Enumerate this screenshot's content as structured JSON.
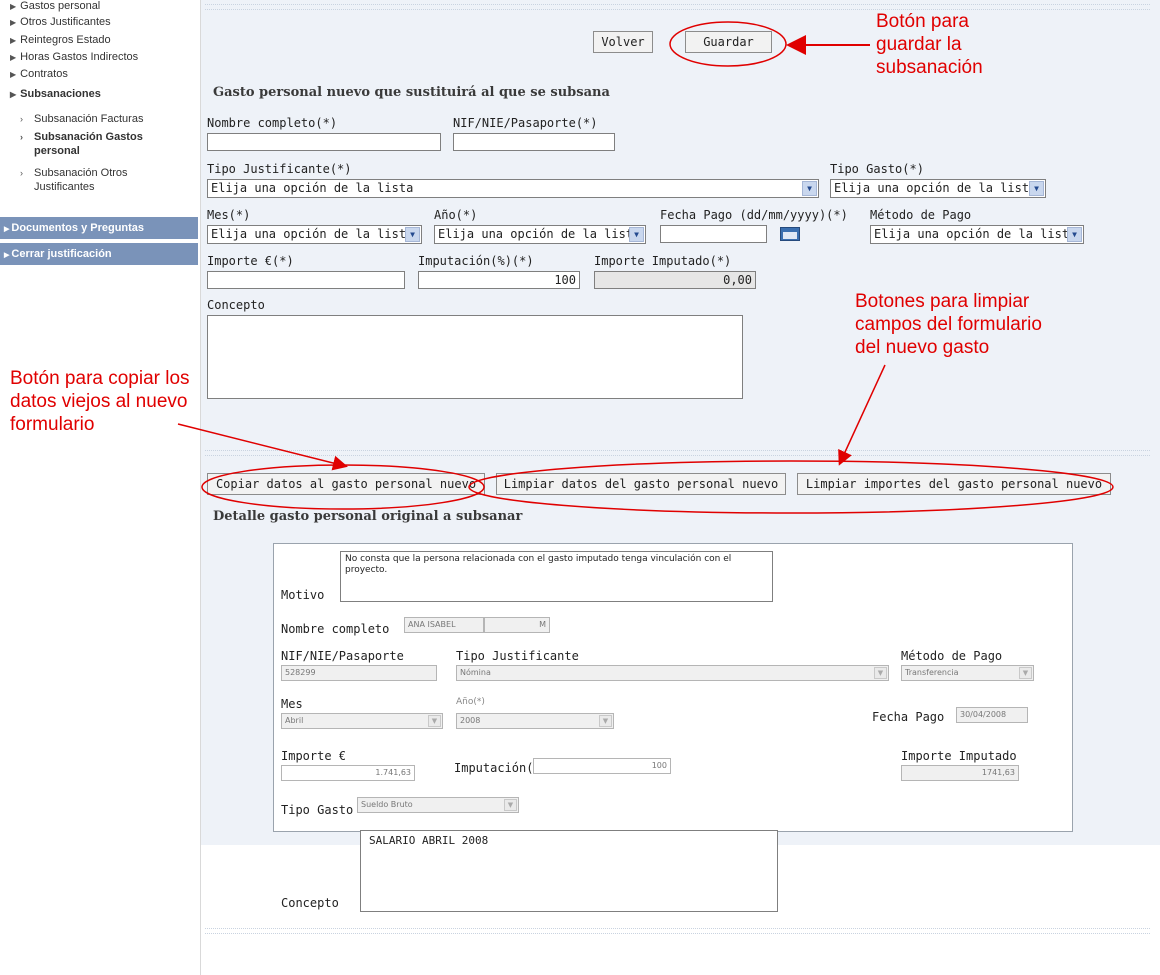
{
  "sidebar": {
    "links": [
      "Gastos personal",
      "Otros Justificantes",
      "Reintegros Estado",
      "Horas Gastos Indirectos",
      "Contratos"
    ],
    "section_label": "Subsanaciones",
    "sub_items": [
      {
        "label": "Subsanación Facturas"
      },
      {
        "label": "Subsanación Gastos personal"
      },
      {
        "label": "Subsanación Otros Justificantes"
      }
    ],
    "blocks": [
      "Documentos y Preguntas",
      "Cerrar justificación"
    ]
  },
  "toolbar": {
    "back_label": "Volver",
    "save_label": "Guardar"
  },
  "new_expense": {
    "title": "Gasto personal nuevo que sustituirá al que se subsana",
    "nombre_label": "Nombre completo(*)",
    "nif_label": "NIF/NIE/Pasaporte(*)",
    "tipo_justificante_label": "Tipo Justificante(*)",
    "tipo_justificante_value": "Elija una opción de la lista",
    "tipo_gasto_label": "Tipo Gasto(*)",
    "tipo_gasto_value": "Elija una opción de la lista",
    "mes_label": "Mes(*)",
    "mes_value": "Elija una opción de la lista",
    "anio_label": "Año(*)",
    "anio_value": "Elija una opción de la lista",
    "fecha_label": "Fecha Pago (dd/mm/yyyy)(*)",
    "metodo_label": "Método de Pago",
    "metodo_value": "Elija una opción de la lista",
    "importe_label": "Importe €(*)",
    "imputacion_label": "Imputación(%)(*)",
    "imputacion_value": "100",
    "importe_imputado_label": "Importe Imputado(*)",
    "importe_imputado_value": "0,00",
    "concepto_label": "Concepto"
  },
  "actions": {
    "copy_label": "Copiar datos al gasto personal nuevo",
    "clear_data_label": "Limpiar datos del gasto personal nuevo",
    "clear_amounts_label": "Limpiar importes del gasto personal nuevo"
  },
  "original": {
    "title": "Detalle gasto personal original a subsanar",
    "motivo_label": "Motivo",
    "motivo_value": "No consta que la persona relacionada con el gasto imputado tenga vinculación con el proyecto.",
    "nombre_label": "Nombre completo",
    "nombre_first": "ANA ISABEL",
    "nombre_last": "M",
    "nif_label": "NIF/NIE/Pasaporte",
    "nif_value": "528299",
    "tipo_justificante_label": "Tipo Justificante",
    "tipo_justificante_value": "Nómina",
    "metodo_label": "Método de Pago",
    "metodo_value": "Transferencia",
    "mes_label": "Mes",
    "mes_value": "Abril",
    "anio_label": "Año(*)",
    "anio_value": "2008",
    "fecha_label": "Fecha Pago",
    "fecha_value": "30/04/2008",
    "importe_label": "Importe €",
    "importe_value": "1.741,63",
    "imputacion_label": "Imputación(%)",
    "imputacion_value": "100",
    "importe_imputado_label": "Importe Imputado",
    "importe_imputado_value": "1741,63",
    "tipo_gasto_label": "Tipo Gasto",
    "tipo_gasto_value": "Sueldo Bruto",
    "concepto_label": "Concepto",
    "concepto_value": "SALARIO ABRIL 2008"
  },
  "annotations": {
    "save_note": [
      "Botón para",
      "guardar la",
      "subsanación"
    ],
    "clear_note": [
      "Botones para limpiar",
      "campos del formulario",
      "del nuevo gasto"
    ],
    "copy_note": [
      "Botón para copiar los",
      "datos viejos al nuevo",
      "formulario"
    ],
    "color": "#e00000"
  },
  "icons": {
    "dropdown": "chevron-down-icon",
    "calendar": "calendar-icon",
    "bullet": "triangle-right-icon"
  }
}
